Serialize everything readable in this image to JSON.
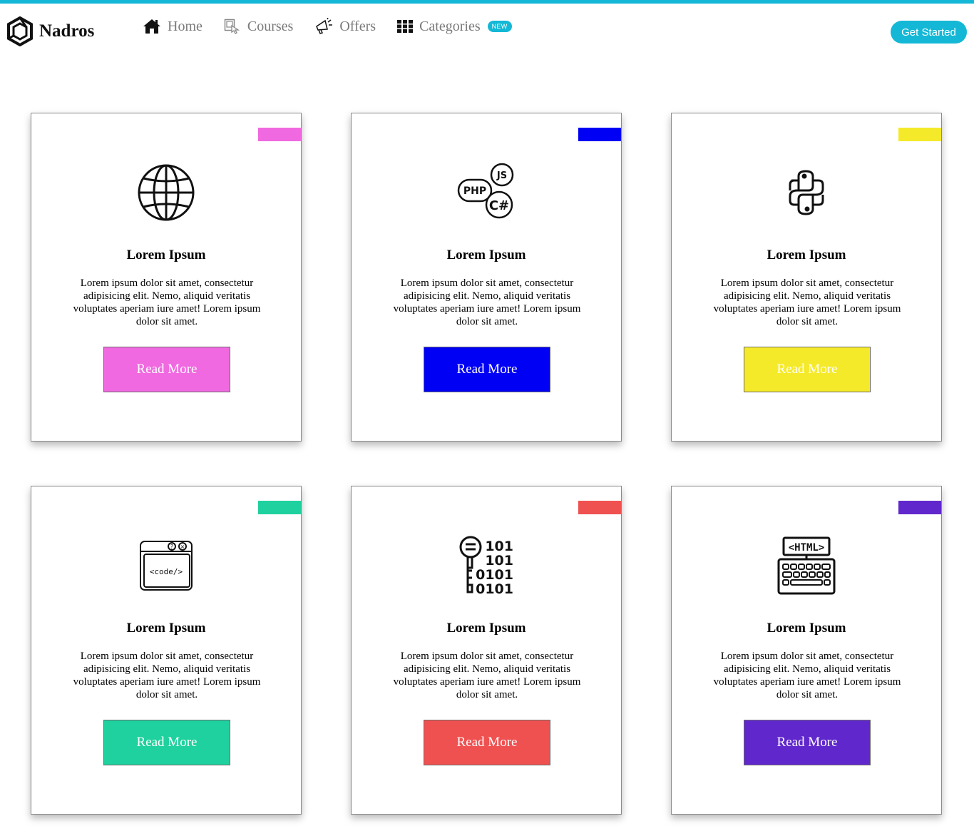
{
  "header": {
    "brand": "Nadros",
    "nav": [
      {
        "label": "Home",
        "icon": "home-icon"
      },
      {
        "label": "Courses",
        "icon": "courses-icon"
      },
      {
        "label": "Offers",
        "icon": "megaphone-icon"
      },
      {
        "label": "Categories",
        "icon": "grid-icon"
      }
    ],
    "badge": "NEW",
    "cta": "Get Started"
  },
  "colors": {
    "topline": "#14b8d6",
    "pink": "#f069e0",
    "blue": "#0000f5",
    "yellow": "#f5ea2a",
    "teal": "#1fd19e",
    "red": "#ef5150",
    "purple": "#6028cc"
  },
  "cards": [
    {
      "title": "Lorem Ipsum",
      "text": "Lorem ipsum dolor sit amet, consectetur adipisicing elit. Nemo, aliquid veritatis voluptates aperiam iure amet! Lorem ipsum dolor sit amet.",
      "button": "Read More",
      "color": "#f069e0",
      "icon": "globe-icon"
    },
    {
      "title": "Lorem Ipsum",
      "text": "Lorem ipsum dolor sit amet, consectetur adipisicing elit. Nemo, aliquid veritatis voluptates aperiam iure amet! Lorem ipsum dolor sit amet.",
      "button": "Read More",
      "color": "#0000f5",
      "icon": "programming-languages-icon"
    },
    {
      "title": "Lorem Ipsum",
      "text": "Lorem ipsum dolor sit amet, consectetur adipisicing elit. Nemo, aliquid veritatis voluptates aperiam iure amet! Lorem ipsum dolor sit amet.",
      "button": "Read More",
      "color": "#f5ea2a",
      "icon": "python-icon"
    },
    {
      "title": "Lorem Ipsum",
      "text": "Lorem ipsum dolor sit amet, consectetur adipisicing elit. Nemo, aliquid veritatis voluptates aperiam iure amet! Lorem ipsum dolor sit amet.",
      "button": "Read More",
      "color": "#1fd19e",
      "icon": "code-window-icon"
    },
    {
      "title": "Lorem Ipsum",
      "text": "Lorem ipsum dolor sit amet, consectetur adipisicing elit. Nemo, aliquid veritatis voluptates aperiam iure amet! Lorem ipsum dolor sit amet.",
      "button": "Read More",
      "color": "#ef5150",
      "icon": "binary-key-icon"
    },
    {
      "title": "Lorem Ipsum",
      "text": "Lorem ipsum dolor sit amet, consectetur adipisicing elit. Nemo, aliquid veritatis voluptates aperiam iure amet! Lorem ipsum dolor sit amet.",
      "button": "Read More",
      "color": "#6028cc",
      "icon": "html-keyboard-icon"
    }
  ],
  "icon_text": {
    "php": "PHP",
    "js": "JS",
    "csharp": "C#",
    "code": "<code/>",
    "binary": [
      "101",
      "101",
      "0101",
      "0101"
    ],
    "html": "<HTML>"
  }
}
